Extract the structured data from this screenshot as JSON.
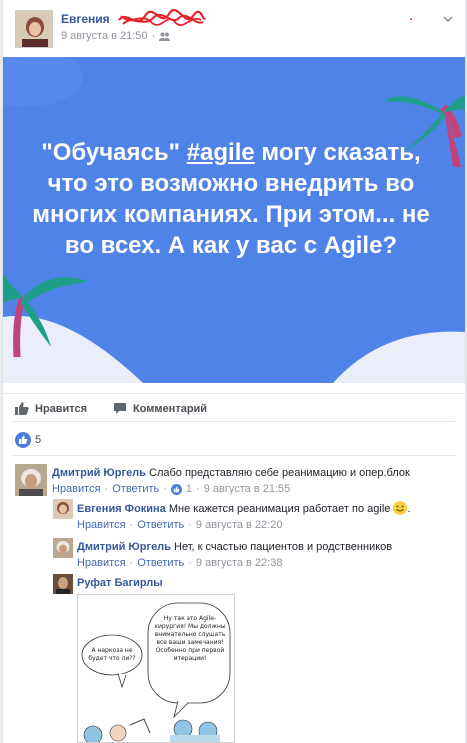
{
  "post": {
    "author": "Евгения",
    "timestamp": "9 августа в 21:50",
    "text_before": "\"Обучаясь\" ",
    "hashtag": "#agile",
    "text_after": " могу сказать, что это возможно внедрить во многих компаниях. При этом... не во всех. А как у вас с Agile?",
    "colors": {
      "background": "#4f83e8",
      "link": "#365899",
      "palm": "#1f9f8a"
    }
  },
  "actions": {
    "like_label": "Нравится",
    "comment_label": "Комментарий"
  },
  "reactions": {
    "count": "5"
  },
  "comments": [
    {
      "author": "Дмитрий Юргель",
      "text": "Слабо представляю себе реанимацию и опер.блок",
      "like_label": "Нравится",
      "reply_label": "Ответить",
      "likes": "1",
      "time": "9 августа в 21:55",
      "replies": [
        {
          "author": "Евгения Фокина",
          "text": "Мне кажется реанимация работает по agile",
          "trailing": ".",
          "emoji": "smile",
          "like_label": "Нравится",
          "reply_label": "Ответить",
          "time": "9 августа в 22:20"
        },
        {
          "author": "Дмитрий Юргель",
          "text": "Нет, к счастью пациентов и родственников",
          "like_label": "Нравится",
          "reply_label": "Ответить",
          "time": "9 августа в 22:38"
        },
        {
          "author": "Руфат Багирлы",
          "image": "cartoon",
          "bubble_left": "А наркоза не будет что ли??",
          "bubble_right": "Ну так это Agile-хирургия! Мы должны внимательно слушать все ваши замечания! Особенно при первой итерации!"
        }
      ]
    }
  ]
}
